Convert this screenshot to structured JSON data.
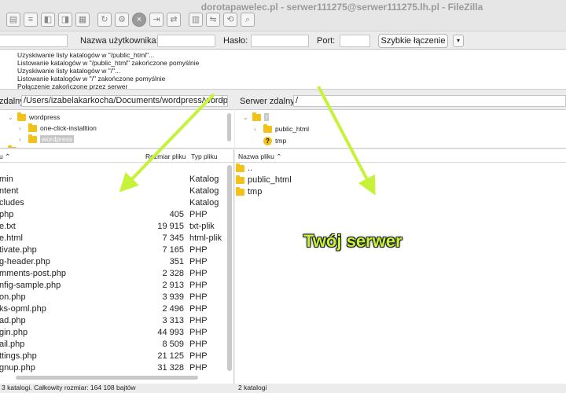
{
  "window": {
    "title": "dorotapawelec.pl - serwer111275@serwer111275.lh.pl - FileZilla"
  },
  "toolbar": {
    "icons": [
      "site-manager-icon",
      "toggle-log-icon",
      "toggle-local-tree-icon",
      "toggle-remote-tree-icon",
      "transfer-queue-icon",
      "refresh-icon",
      "process-queue-icon",
      "cancel-icon",
      "disconnect-icon",
      "reconnect-icon",
      "filter-icon",
      "compare-icon",
      "sync-browse-icon",
      "search-icon"
    ]
  },
  "quickconnect": {
    "user_label": "Nazwa użytkownika:",
    "password_label": "Hasło:",
    "port_label": "Port:",
    "connect_button": "Szybkie łączenie",
    "dropdown": "▾"
  },
  "log": [
    "Uzyskiwanie listy katalogów w \"/public_html\"...",
    "Listowanie katalogów w \"/public_html\" zakończone pomyślnie",
    "Uzyskiwanie listy katalogów w \"/\"...",
    "Listowanie katalogów w \"/\" zakończone pomyślnie",
    "Połączenie zakończone przez serwer"
  ],
  "local": {
    "path_label": "zdalny:",
    "path_value": "/Users/izabelakarkocha/Documents/wordpress/wordpre",
    "tree": [
      "wordpress",
      "one-click-installtion",
      "wordpress"
    ],
    "columns": {
      "name": "u",
      "size": "Rozmiar pliku",
      "type": "Typ pliku"
    },
    "rows": [
      {
        "name": "min",
        "size": "",
        "type": "Katalog"
      },
      {
        "name": "ntent",
        "size": "",
        "type": "Katalog"
      },
      {
        "name": "cludes",
        "size": "",
        "type": "Katalog"
      },
      {
        "name": "php",
        "size": "405",
        "type": "PHP"
      },
      {
        "name": "e.txt",
        "size": "19 915",
        "type": "txt-plik"
      },
      {
        "name": "e.html",
        "size": "7 345",
        "type": "html-plik"
      },
      {
        "name": "tivate.php",
        "size": "7 165",
        "type": "PHP"
      },
      {
        "name": "g-header.php",
        "size": "351",
        "type": "PHP"
      },
      {
        "name": "mments-post.php",
        "size": "2 328",
        "type": "PHP"
      },
      {
        "name": "nfig-sample.php",
        "size": "2 913",
        "type": "PHP"
      },
      {
        "name": "on.php",
        "size": "3 939",
        "type": "PHP"
      },
      {
        "name": "ks-opml.php",
        "size": "2 496",
        "type": "PHP"
      },
      {
        "name": "ad.php",
        "size": "3 313",
        "type": "PHP"
      },
      {
        "name": "gin.php",
        "size": "44 993",
        "type": "PHP"
      },
      {
        "name": "ail.php",
        "size": "8 509",
        "type": "PHP"
      },
      {
        "name": "ttings.php",
        "size": "21 125",
        "type": "PHP"
      },
      {
        "name": "gnup.php",
        "size": "31 328",
        "type": "PHP"
      }
    ],
    "status": "3 katalogi. Całkowity rozmiar: 164 108 bajtów"
  },
  "remote": {
    "path_label": "Serwer zdalny:",
    "path_value": "/",
    "tree": [
      "/",
      "public_html",
      "tmp"
    ],
    "columns": {
      "name": "Nazwa pliku"
    },
    "rows": [
      {
        "name": ".."
      },
      {
        "name": "public_html"
      },
      {
        "name": "tmp"
      }
    ],
    "status": "2 katalogi"
  },
  "annotation": {
    "text": "Twój serwer",
    "color": "#c6f33a"
  }
}
